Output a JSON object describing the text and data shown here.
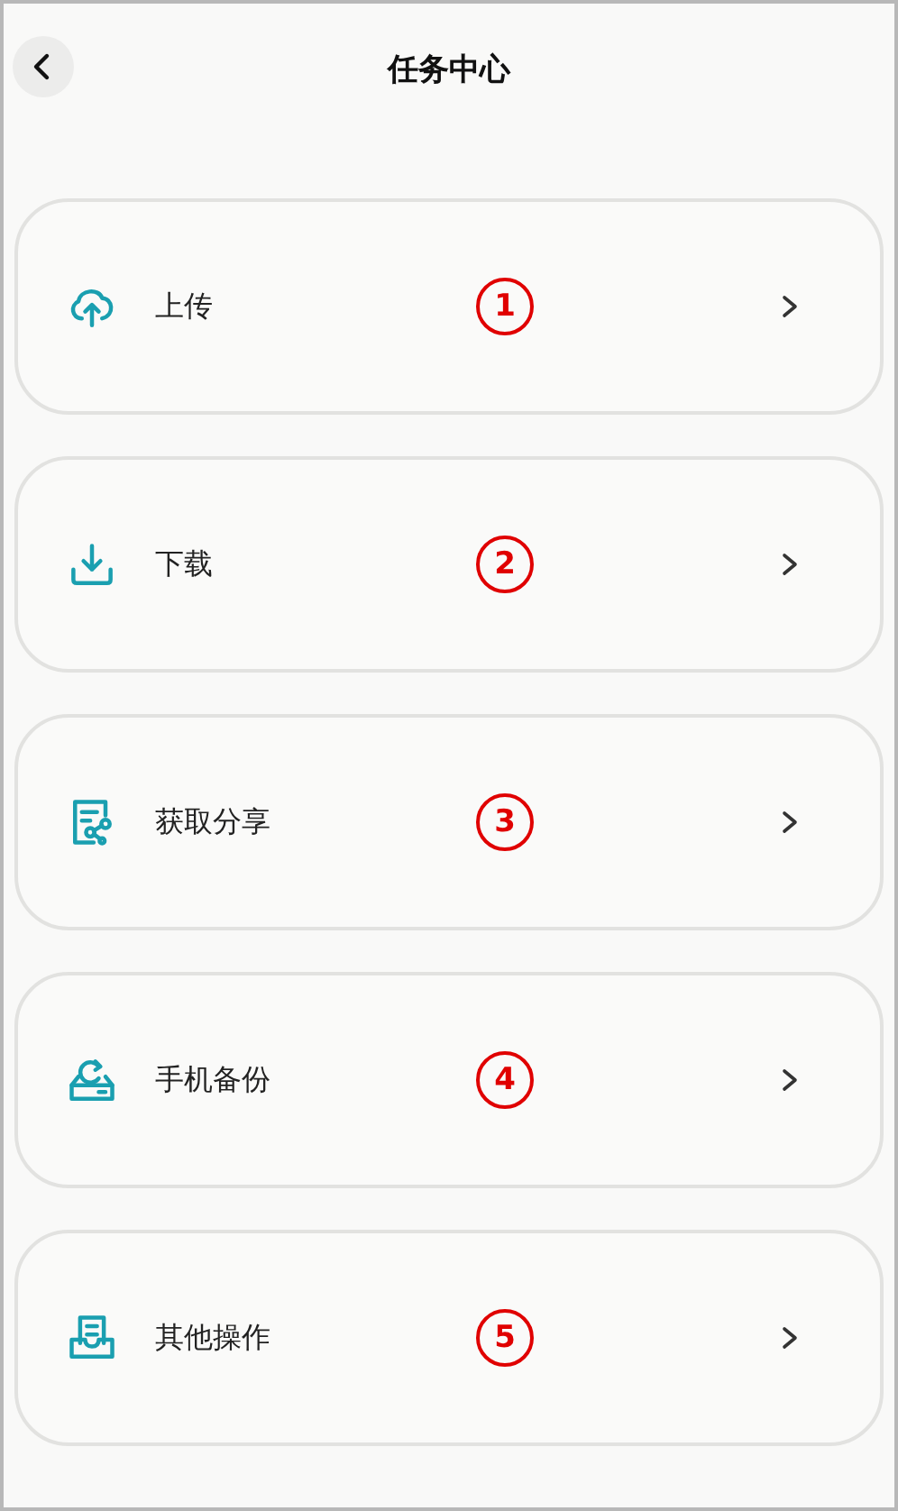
{
  "header": {
    "title": "任务中心"
  },
  "items": [
    {
      "kind": "upload",
      "label": "上传",
      "marker": "1"
    },
    {
      "kind": "download",
      "label": "下载",
      "marker": "2"
    },
    {
      "kind": "share",
      "label": "获取分享",
      "marker": "3"
    },
    {
      "kind": "backup",
      "label": "手机备份",
      "marker": "4"
    },
    {
      "kind": "other",
      "label": "其他操作",
      "marker": "5"
    }
  ]
}
